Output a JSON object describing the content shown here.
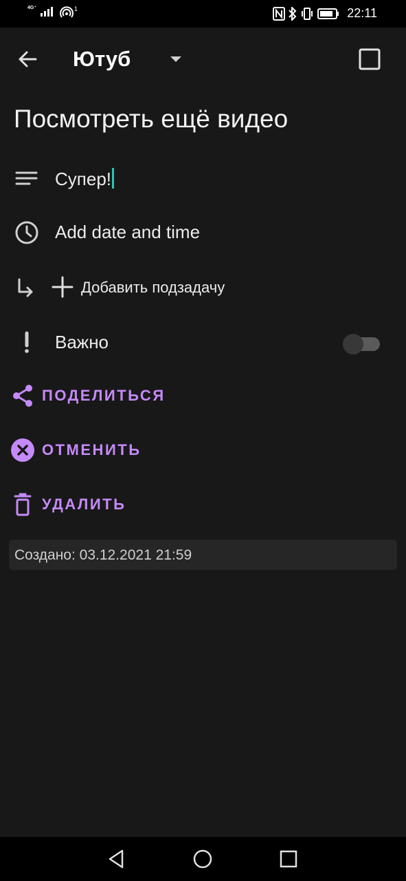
{
  "status_bar": {
    "network": "4G⁺",
    "hotspot_count": "1",
    "time": "22:11",
    "icons": [
      "signal-icon",
      "hotspot-icon",
      "nfc-icon",
      "bluetooth-icon",
      "vibrate-icon",
      "battery-icon"
    ]
  },
  "app_bar": {
    "list_name": "Ютуб",
    "icons": {
      "back": "arrow-left-icon",
      "dropdown": "triangle-down-icon",
      "complete": "checkbox-empty-icon"
    }
  },
  "task": {
    "title": "Посмотреть ещё видео",
    "note": "Супер!",
    "date_label": "Add date and time",
    "add_subtask_label": "Добавить подзадачу",
    "important_label": "Важно",
    "important_enabled": false
  },
  "actions": {
    "share_label": "ПОДЕЛИТЬСЯ",
    "cancel_label": "ОТМЕНИТЬ",
    "delete_label": "УДАЛИТЬ"
  },
  "created": "Создано: 03.12.2021 21:59",
  "colors": {
    "background": "#181818",
    "accent": "#c58af9",
    "cursor": "#2ec4b6",
    "text": "#ececec",
    "created_box": "#262626"
  },
  "nav_bar": {
    "icons": [
      "back-triangle-icon",
      "home-circle-icon",
      "recents-square-icon"
    ]
  }
}
